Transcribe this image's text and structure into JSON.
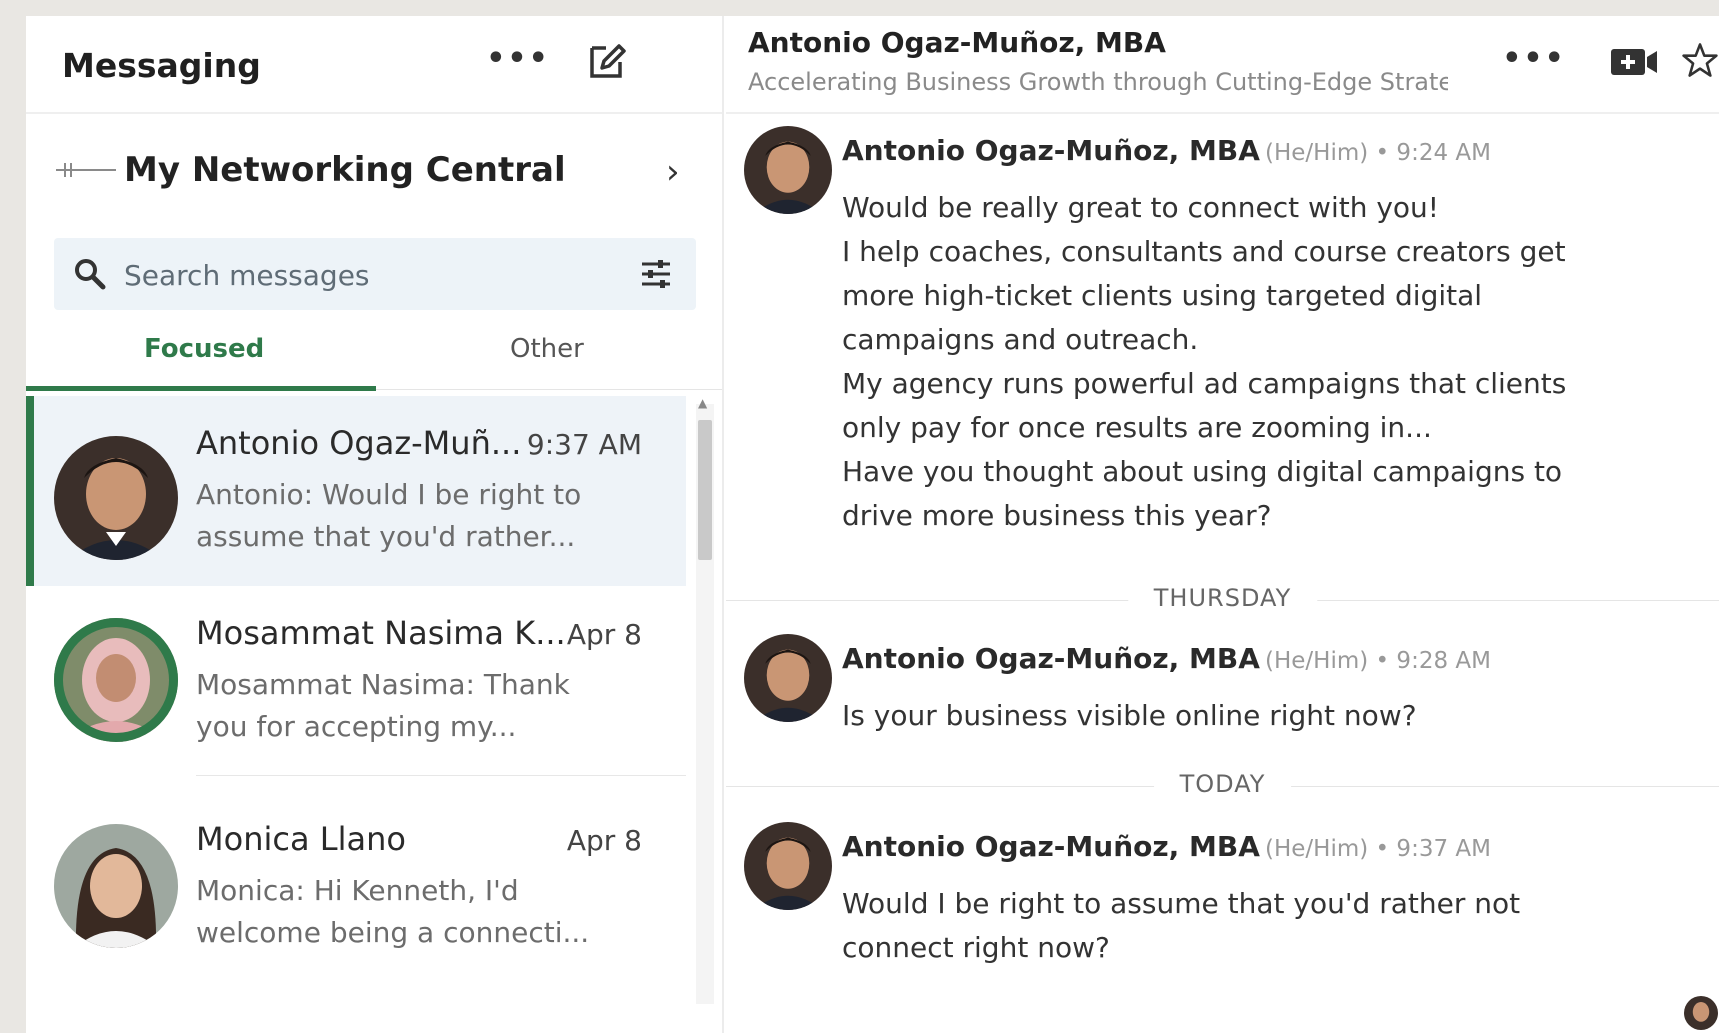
{
  "left_header": {
    "title": "Messaging"
  },
  "network": {
    "label": "My Networking Central"
  },
  "search": {
    "placeholder": "Search messages"
  },
  "tabs": [
    {
      "label": "Focused"
    },
    {
      "label": "Other"
    }
  ],
  "conversations": [
    {
      "name": "Antonio Ogaz-Muñ...",
      "date": "9:37 AM",
      "preview": "Antonio: Would I be right to assume that you'd rather..."
    },
    {
      "name": "Mosammat Nasima K...",
      "date": "Apr 8",
      "preview": "Mosammat Nasima: Thank you for accepting my..."
    },
    {
      "name": "Monica Llano",
      "date": "Apr 8",
      "preview": "Monica: Hi Kenneth, I'd welcome being a connecti..."
    }
  ],
  "thread": {
    "name": "Antonio Ogaz-Muñoz, MBA",
    "headline": "Accelerating Business Growth through Cutting-Edge Strate|",
    "messages": [
      {
        "sender": "Antonio Ogaz-Muñoz, MBA",
        "meta": "(He/Him) • 9:24 AM",
        "lines": [
          "Would be really great to connect with you!",
          "I help coaches, consultants and course creators get",
          "more high-ticket clients using targeted digital",
          "campaigns and outreach.",
          "My agency runs powerful ad campaigns that clients",
          "only pay for once results are zooming in...",
          "Have you thought about using digital campaigns to",
          "drive more business this year?"
        ]
      },
      {
        "sender": "Antonio Ogaz-Muñoz, MBA",
        "meta": "(He/Him) • 9:28 AM",
        "lines": [
          "Is your business visible online right now?"
        ]
      },
      {
        "sender": "Antonio Ogaz-Muñoz, MBA",
        "meta": "(He/Him) • 9:37 AM",
        "lines": [
          "Would I be right to assume that you'd rather not",
          "connect right now?"
        ]
      }
    ],
    "day_separators": [
      "THURSDAY",
      "TODAY"
    ]
  },
  "icons": {
    "more": "more-dots-icon",
    "compose": "compose-icon",
    "search": "search-icon",
    "filter": "filter-icon",
    "chevron": "chevron-right-icon",
    "video": "video-icon",
    "star": "star-icon"
  },
  "colors": {
    "accent": "#2f7a4a",
    "search_bg": "#edf3f8",
    "active_row": "#eef3f8"
  }
}
